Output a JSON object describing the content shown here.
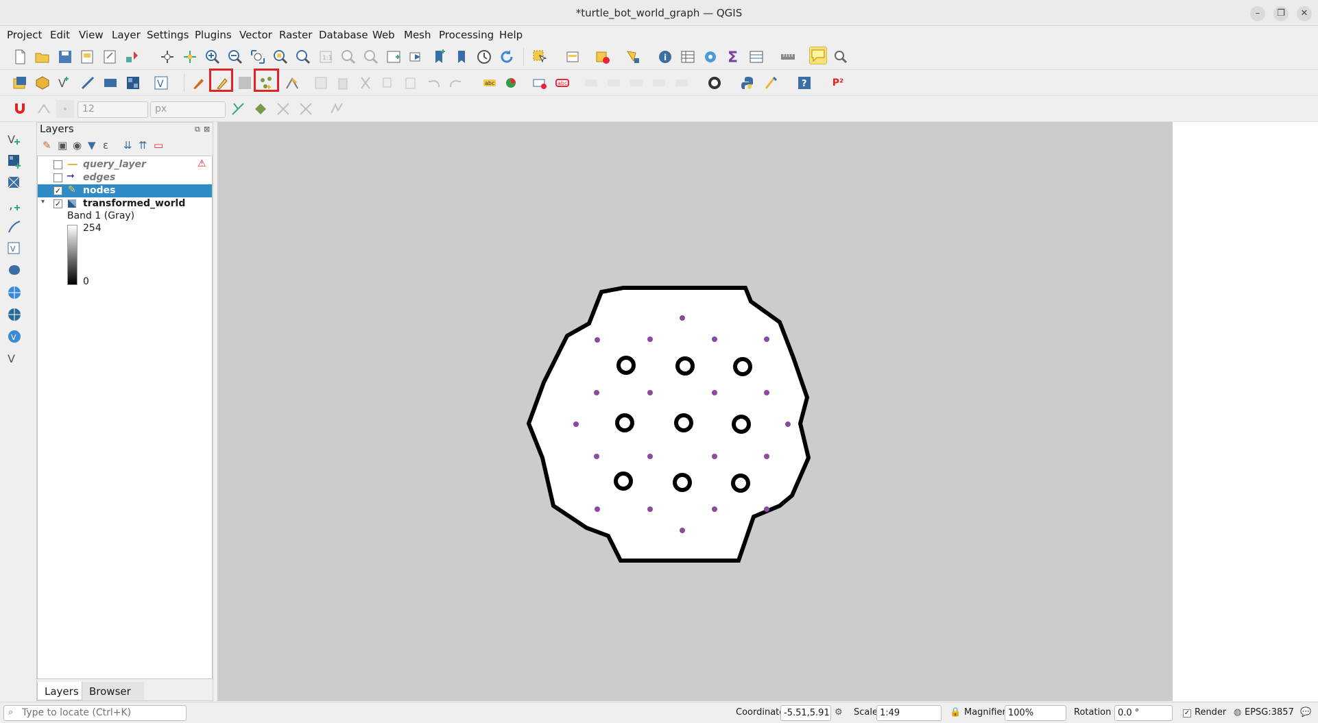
{
  "window": {
    "title": "*turtle_bot_world_graph — QGIS",
    "min": "–",
    "max": "❐",
    "close": "✕"
  },
  "menu": [
    "Project",
    "Edit",
    "View",
    "Layer",
    "Settings",
    "Plugins",
    "Vector",
    "Raster",
    "Database",
    "Web",
    "Mesh",
    "Processing",
    "Help"
  ],
  "snap": {
    "tolerance": "12",
    "unit": "px"
  },
  "plugin_label": "P²",
  "layers_panel": {
    "title": "Layers",
    "layers": [
      {
        "name": "query_layer",
        "checked": false,
        "italic": true,
        "warning": true
      },
      {
        "name": "edges",
        "checked": false,
        "italic": true
      },
      {
        "name": "nodes",
        "checked": true,
        "selected": true
      },
      {
        "name": "transformed_world",
        "checked": true
      }
    ],
    "band": "Band 1 (Gray)",
    "band_max": "254",
    "band_min": "0",
    "tabs": [
      "Layers",
      "Browser"
    ]
  },
  "colors": {
    "accent": "#308cc6",
    "node": "#8b4a9e",
    "highlight": "#e02424",
    "canvas": "#cccccc"
  },
  "statusbar": {
    "locate_placeholder": "Type to locate (Ctrl+K)",
    "coordinate_label": "Coordinate",
    "coordinate": "-5.51,5.91",
    "scale_label": "Scale",
    "scale": "1:49",
    "magnifier_label": "Magnifier",
    "magnifier": "100%",
    "rotation_label": "Rotation",
    "rotation": "0.0 °",
    "render_label": "Render",
    "crs": "EPSG:3857"
  }
}
